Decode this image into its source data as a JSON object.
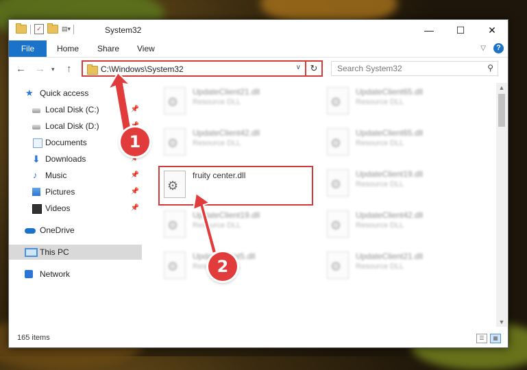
{
  "window": {
    "title": "System32",
    "controls": {
      "minimize": "—",
      "maximize": "☐",
      "close": "✕"
    }
  },
  "ribbon": {
    "tabs": [
      "File",
      "Home",
      "Share",
      "View"
    ]
  },
  "address_bar": {
    "path": "C:\\Windows\\System32"
  },
  "search": {
    "placeholder": "Search System32"
  },
  "sidebar": {
    "items": [
      {
        "label": "Quick access",
        "icon": "star-icon"
      },
      {
        "label": "Local Disk (C:)",
        "icon": "disk-icon",
        "pinned": true
      },
      {
        "label": "Local Disk (D:)",
        "icon": "disk-icon",
        "pinned": true
      },
      {
        "label": "Documents",
        "icon": "document-icon",
        "pinned": true
      },
      {
        "label": "Downloads",
        "icon": "download-icon",
        "pinned": true
      },
      {
        "label": "Music",
        "icon": "music-icon",
        "pinned": true
      },
      {
        "label": "Pictures",
        "icon": "pictures-icon",
        "pinned": true
      },
      {
        "label": "Videos",
        "icon": "videos-icon",
        "pinned": true
      },
      {
        "label": "OneDrive",
        "icon": "onedrive-icon"
      },
      {
        "label": "This PC",
        "icon": "pc-icon",
        "selected": true
      },
      {
        "label": "Network",
        "icon": "network-icon"
      }
    ]
  },
  "files": [
    {
      "name": "UpdateClient21.dll",
      "type": "Resource DLL"
    },
    {
      "name": "UpdateClient65.dll",
      "type": "Resource DLL"
    },
    {
      "name": "UpdateClient42.dll",
      "type": "Resource DLL"
    },
    {
      "name": "UpdateClient65.dll",
      "type": "Resource DLL"
    },
    {
      "name": "fruity center.dll",
      "type": ""
    },
    {
      "name": "UpdateClient19.dll",
      "type": "Resource DLL"
    },
    {
      "name": "UpdateClient19.dll",
      "type": "Resource DLL"
    },
    {
      "name": "UpdateClient42.dll",
      "type": "Resource DLL"
    },
    {
      "name": "UpdateClient5.dll",
      "type": "Resource DLL"
    },
    {
      "name": "UpdateClient21.dll",
      "type": "Resource DLL"
    }
  ],
  "status": {
    "item_count": "165 items"
  },
  "annotations": {
    "step1": "1",
    "step2": "2"
  },
  "colors": {
    "accent": "#1a73c9",
    "annotation_red": "#d33a3a"
  }
}
